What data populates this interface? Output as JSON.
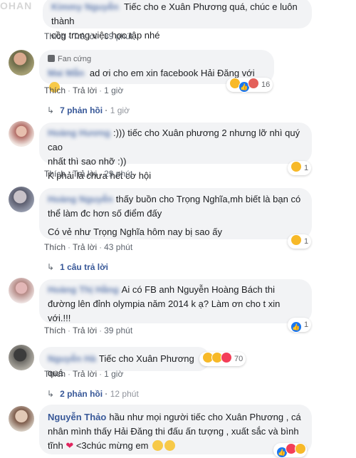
{
  "watermark": "OHAN",
  "comments": [
    {
      "text": "Tiếc cho e Xuân Phương quá, chúc e luôn thành công trong việc học tập nhé",
      "text_line1": "Tiếc cho e Xuân Phương quá, chúc e luôn thành",
      "text_line2": "cồg trong việc học tập nhé",
      "like_label": "Thích",
      "reply_label": "Trả lời",
      "time": "39 phút"
    },
    {
      "badge": "Fan cứng",
      "text": "ad ơi cho em xin facebook Hải Đăng với",
      "like_label": "Thích",
      "reply_label": "Trả lời",
      "time": "1 giờ",
      "reaction_count": "16",
      "replies_label": "7 phản hồi",
      "replies_time": "1 giờ"
    },
    {
      "text_line1": ":))) tiếc cho Xuân phương 2 nhưng lỡ nhì quý cao",
      "text_line2": "nhất thì sao nhỡ :))",
      "text_line3": "K phải là chưa hết cơ hội",
      "like_label": "Thích",
      "reply_label": "Trả lời",
      "time": "29 phút",
      "reaction_count": "1"
    },
    {
      "text_line1": "thấy buồn cho Trọng Nghĩa,mh biết là bạn có",
      "text_line2": "thể làm đc hơn số điểm đấy",
      "text_line3": "Có vẻ như Trọng Nghĩa hôm nay bị sao ấy",
      "like_label": "Thích",
      "reply_label": "Trả lời",
      "time": "43 phút",
      "reaction_count": "1",
      "replies_label": "1 câu trả lời"
    },
    {
      "text_line1": "Ai có FB anh Nguyễn Hoàng Bách thi",
      "text_line2": "đường lên đỉnh olympia năm 2014 k ạ? Làm ơn cho t xin",
      "text_line3": "với.!!!",
      "like_label": "Thích",
      "reply_label": "Trả lời",
      "time": "39 phút",
      "reaction_count": "1"
    },
    {
      "text": "Tiếc cho Xuân Phương quá",
      "like_label": "Thích",
      "reply_label": "Trả lời",
      "time": "1 giờ",
      "reaction_count": "70",
      "replies_label": "2 phản hồi",
      "replies_time": "12 phút"
    },
    {
      "author": "Nguyễn Thảo",
      "text_line1": "hầu như mọi người tiếc cho Xuân Phương , cá",
      "text_line2": "nhân mình thấy Hải Đăng thi đấu ấn tượng , xuất sắc và bình",
      "text_line3": "tĩnh",
      "text_line3_rest": "<3chúc mừng em"
    }
  ]
}
